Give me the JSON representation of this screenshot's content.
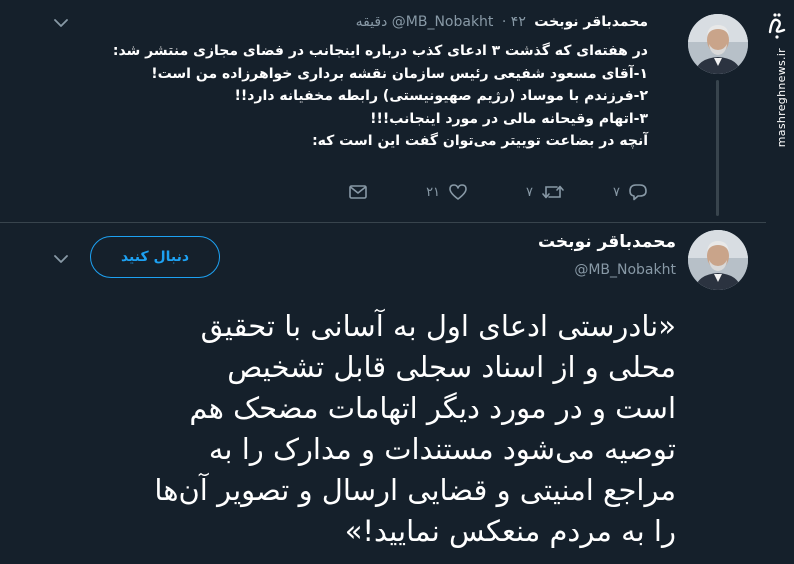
{
  "watermark": {
    "logo": "مشرق",
    "site": "mashreghnews.ir"
  },
  "reply_tweet": {
    "author_name": "محمدباقر نوبخت",
    "handle": "@MB_Nobakht",
    "time": "۴۲ دقیقه",
    "lines": [
      "در هفته‌ای که گذشت ۳ ادعای کذب درباره اینجانب در فضای مجازی منتشر شد:",
      "۱-آقای مسعود شفیعی رئیس سازمان نقشه برداری خواهرزاده من است!",
      "۲-فرزندم با موساد (رژیم صهیونیستی) رابطه مخفیانه دارد!!",
      "۳-اتهام وقیحانه مالی در مورد اینجانب!!!",
      "آنچه در بضاعت توییتر می‌توان گفت این است که:"
    ],
    "actions": {
      "reply_count": "۷",
      "retweet_count": "۷",
      "like_count": "۲۱"
    }
  },
  "main_tweet": {
    "author_name": "محمدباقر نوبخت",
    "handle": "@MB_Nobakht",
    "follow_label": "دنبال کنید",
    "lines": [
      "«نادرستی ادعای اول به آسانی با تحقیق",
      "محلی و از اسناد سجلی قابل تشخیص",
      "است و در مورد دیگر اتهامات مضحک هم",
      "توصیه می‌شود مستندات و مدارک را به",
      "مراجع امنیتی و قضایی ارسال و تصویر آن‌ها",
      "را به مردم منعکس نمایید!»"
    ]
  },
  "colors": {
    "background": "#15202b",
    "accent": "#1da1f2",
    "muted": "#8899a6",
    "divider": "#38444d"
  },
  "icons": [
    "chevron-down-icon",
    "reply-icon",
    "retweet-icon",
    "like-icon",
    "message-icon"
  ]
}
